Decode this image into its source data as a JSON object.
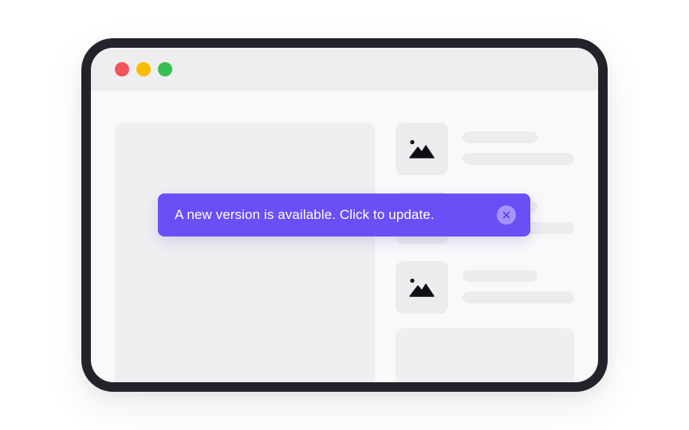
{
  "window": {
    "controls": [
      "close",
      "minimize",
      "maximize"
    ],
    "control_colors": {
      "close": "#f2545b",
      "minimize": "#fbbc05",
      "maximize": "#37c04f"
    },
    "frame_color": "#23242b",
    "background_color": "#f9f9fa",
    "placeholder_color": "#ececee"
  },
  "content": {
    "list_items": [
      {
        "icon": "image-icon"
      },
      {
        "icon": "image-icon"
      },
      {
        "icon": "image-icon"
      }
    ]
  },
  "toast": {
    "message": "A new version is available. Click to update.",
    "close_icon": "close-icon",
    "background_color": "#6a4ff7",
    "close_button_color": "#a495fb"
  }
}
